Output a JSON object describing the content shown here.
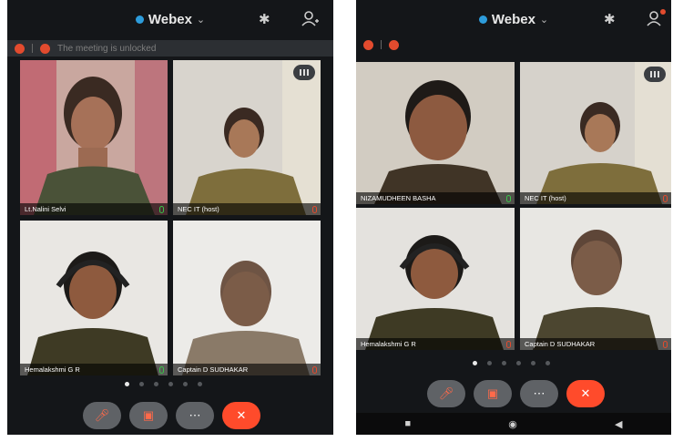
{
  "left": {
    "app_name": "Webex",
    "notice": "The meeting is unlocked",
    "tiles": [
      {
        "name": "Lt.Nalini Selvi"
      },
      {
        "name": "NEC IT (host)"
      },
      {
        "name": "Hemalakshmi G R"
      },
      {
        "name": "Captain D SUDHAKAR"
      }
    ],
    "page_dots": 6,
    "active_dot": 0
  },
  "right": {
    "app_name": "Webex",
    "tiles": [
      {
        "name": "NIZAMUDHEEN BASHA"
      },
      {
        "name": "NEC IT (host)"
      },
      {
        "name": "Hemalakshmi G R"
      },
      {
        "name": "Captain D SUDHAKAR"
      }
    ],
    "page_dots": 6,
    "active_dot": 0
  },
  "controls": {
    "mute_icon": "mic-off-icon",
    "video_icon": "video-off-icon",
    "more_icon": "more-icon",
    "leave_icon": "close-icon"
  },
  "colors": {
    "accent": "#2d9cdb",
    "leave": "#ff4b2b",
    "muted": "#e24b2e",
    "active_mic": "#3bc24a"
  }
}
